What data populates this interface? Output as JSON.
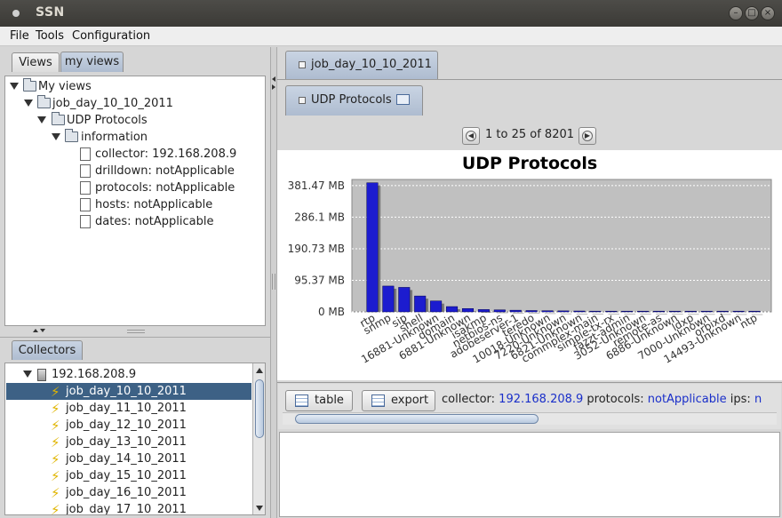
{
  "window": {
    "title": "SSN"
  },
  "menu": {
    "file": "File",
    "tools": "Tools",
    "configuration": "Configuration"
  },
  "left": {
    "tabs": {
      "views": "Views",
      "my_views": "my views"
    },
    "tree": {
      "root": "My views",
      "job": "job_day_10_10_2011",
      "udp": "UDP Protocols",
      "info": "information",
      "leaves": [
        "collector: 192.168.208.9",
        "drilldown: notApplicable",
        "protocols: notApplicable",
        "hosts: notApplicable",
        "dates: notApplicable"
      ]
    },
    "collectors_tab": "Collectors",
    "collectors": {
      "host": "192.168.208.9",
      "jobs": [
        "job_day_10_10_2011",
        "job_day_11_10_2011",
        "job_day_12_10_2011",
        "job_day_13_10_2011",
        "job_day_14_10_2011",
        "job_day_15_10_2011",
        "job_day_16_10_2011",
        "job_day_17_10_2011"
      ],
      "selected_index": 0
    }
  },
  "right": {
    "tab1": "job_day_10_10_2011",
    "tab2": "UDP Protocols",
    "pager": "1 to 25 of 8201",
    "bottom": {
      "table_btn": "table",
      "export_btn": "export",
      "collector_label": "collector:",
      "collector_value": "192.168.208.9",
      "protocols_label": "protocols:",
      "protocols_value": "notApplicable",
      "ips_label": "ips:",
      "ips_value": "n",
      "link_color": "#1a2fc9"
    }
  },
  "chart_data": {
    "type": "bar",
    "title": "UDP Protocols",
    "xlabel": "",
    "ylabel": "",
    "y_ticks": [
      "0 MB",
      "95.37 MB",
      "190.73 MB",
      "286.1 MB",
      "381.47 MB"
    ],
    "ylim": [
      0,
      400
    ],
    "categories": [
      "rtp",
      "snmp",
      "sip",
      "shell",
      "16881-Unknown",
      "domain",
      "6881-Unknown",
      "isakmp",
      "netbios-ns",
      "adobeserver-1",
      "teredo",
      "10018-Unknown",
      "7220-Unknown",
      "6821-Unknown",
      "commplex-main",
      "simple-tx-rx",
      "fazzt-admin",
      "3052-Unknown",
      "remote-as",
      "6886-Unknown",
      "ldxp",
      "7000-Unknown",
      "orbixd",
      "14493-Unknown",
      "ntp"
    ],
    "values": [
      390,
      78,
      74,
      48,
      33,
      16,
      10,
      7,
      6,
      5,
      4,
      3.5,
      3,
      2.6,
      2.2,
      2,
      1.8,
      1.6,
      1.4,
      1.2,
      1.1,
      1,
      0.9,
      0.8,
      0.6
    ],
    "bar_color": "#1c1ccf",
    "plot_bg": "#c0c0c0",
    "grid": true,
    "legend": "none"
  }
}
